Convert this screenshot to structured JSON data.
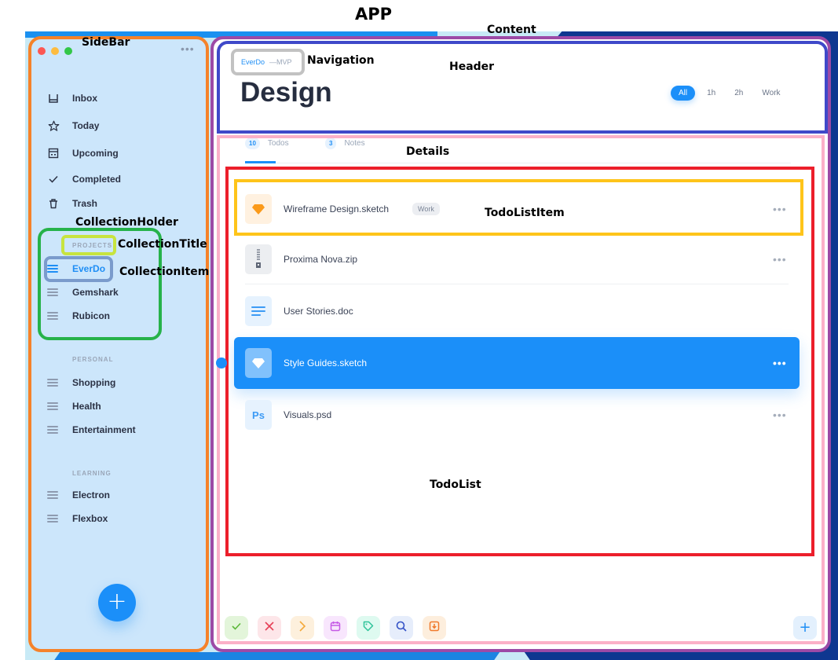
{
  "annotations": {
    "app": "APP",
    "sidebar": "SideBar",
    "content": "Content",
    "navigation": "Navigation",
    "header": "Header",
    "details": "Details",
    "collection_holder": "CollectionHolder",
    "collection_title": "CollectionTitle",
    "collection_item": "CollectionItem",
    "todo_list_item": "TodoListItem",
    "todo_list": "TodoList"
  },
  "colors": {
    "accent": "#1b8ff9",
    "sidebar_bg": "#cce6fb",
    "text_dark": "#262d3f",
    "traffic_red": "#fc5753",
    "traffic_yellow": "#fdbc40",
    "traffic_green": "#33c748"
  },
  "sidebar": {
    "more_label": "•••",
    "nav": [
      {
        "label": "Inbox",
        "icon": "inbox-icon"
      },
      {
        "label": "Today",
        "icon": "star-icon"
      },
      {
        "label": "Upcoming",
        "icon": "calendar-icon"
      },
      {
        "label": "Completed",
        "icon": "check-icon"
      },
      {
        "label": "Trash",
        "icon": "trash-icon"
      }
    ],
    "collections": [
      {
        "title": "PROJECTS",
        "items": [
          {
            "label": "EverDo",
            "active": true
          },
          {
            "label": "Gemshark"
          },
          {
            "label": "Rubicon"
          }
        ]
      },
      {
        "title": "PERSONAL",
        "items": [
          {
            "label": "Shopping"
          },
          {
            "label": "Health"
          },
          {
            "label": "Entertainment"
          }
        ]
      },
      {
        "title": "LEARNING",
        "items": [
          {
            "label": "Electron"
          },
          {
            "label": "Flexbox"
          }
        ]
      }
    ],
    "add_label": "+"
  },
  "content": {
    "breadcrumb": {
      "project": "EverDo",
      "separator_sub": "—MVP"
    },
    "title": "Design",
    "filters": [
      {
        "label": "All",
        "active": true
      },
      {
        "label": "1h"
      },
      {
        "label": "2h"
      },
      {
        "label": "Work"
      }
    ],
    "tabs": [
      {
        "count": "10",
        "label": "Todos",
        "active": true
      },
      {
        "count": "3",
        "label": "Notes"
      }
    ],
    "todos": [
      {
        "name": "Wireframe Design.sketch",
        "tag": "Work",
        "icon": "sketch-icon",
        "more": "•••"
      },
      {
        "name": "Proxima Nova.zip",
        "icon": "zip-icon",
        "more": "•••"
      },
      {
        "name": "User Stories.doc",
        "icon": "doc-icon",
        "more": ""
      },
      {
        "name": "Style Guides.sketch",
        "icon": "sketch-icon",
        "selected": true,
        "more": "•••"
      },
      {
        "name": "Visuals.psd",
        "icon": "psd-icon",
        "icon_text": "Ps",
        "more": "•••"
      }
    ],
    "toolbar": [
      {
        "name": "complete",
        "icon": "check-icon"
      },
      {
        "name": "delete",
        "icon": "close-icon"
      },
      {
        "name": "forward",
        "icon": "chevron-right-icon"
      },
      {
        "name": "schedule",
        "icon": "calendar-icon"
      },
      {
        "name": "tag",
        "icon": "tag-icon"
      },
      {
        "name": "search",
        "icon": "search-icon"
      },
      {
        "name": "import",
        "icon": "import-icon"
      }
    ],
    "add_label": "+"
  }
}
